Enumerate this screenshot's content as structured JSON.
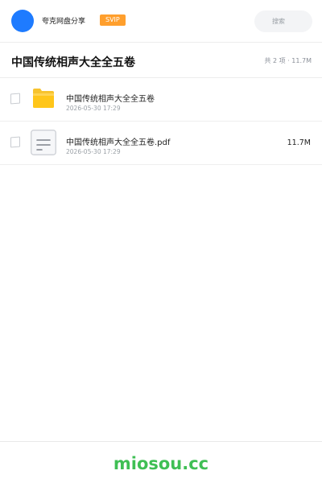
{
  "header": {
    "user_name": "夸克网盘分享",
    "vip_badge": "SVIP",
    "search_placeholder": "搜索",
    "avatar_color": "#1e7bff",
    "vip_color": "#ff9f2d"
  },
  "folder": {
    "title": "中国传统相声大全全五卷",
    "summary": "共 2 项 · 11.7M"
  },
  "files": [
    {
      "name": "中国传统相声大全全五卷",
      "date": "2026-05-30 17:29",
      "size": "",
      "icon": "folder-icon"
    },
    {
      "name": "中国传统相声大全全五卷.pdf",
      "date": "2026-05-30 17:29",
      "size": "11.7M",
      "icon": "pdf-document-icon"
    }
  ],
  "footer": {
    "watermark": "miosou.cc",
    "watermark_color": "#3fbf54"
  }
}
